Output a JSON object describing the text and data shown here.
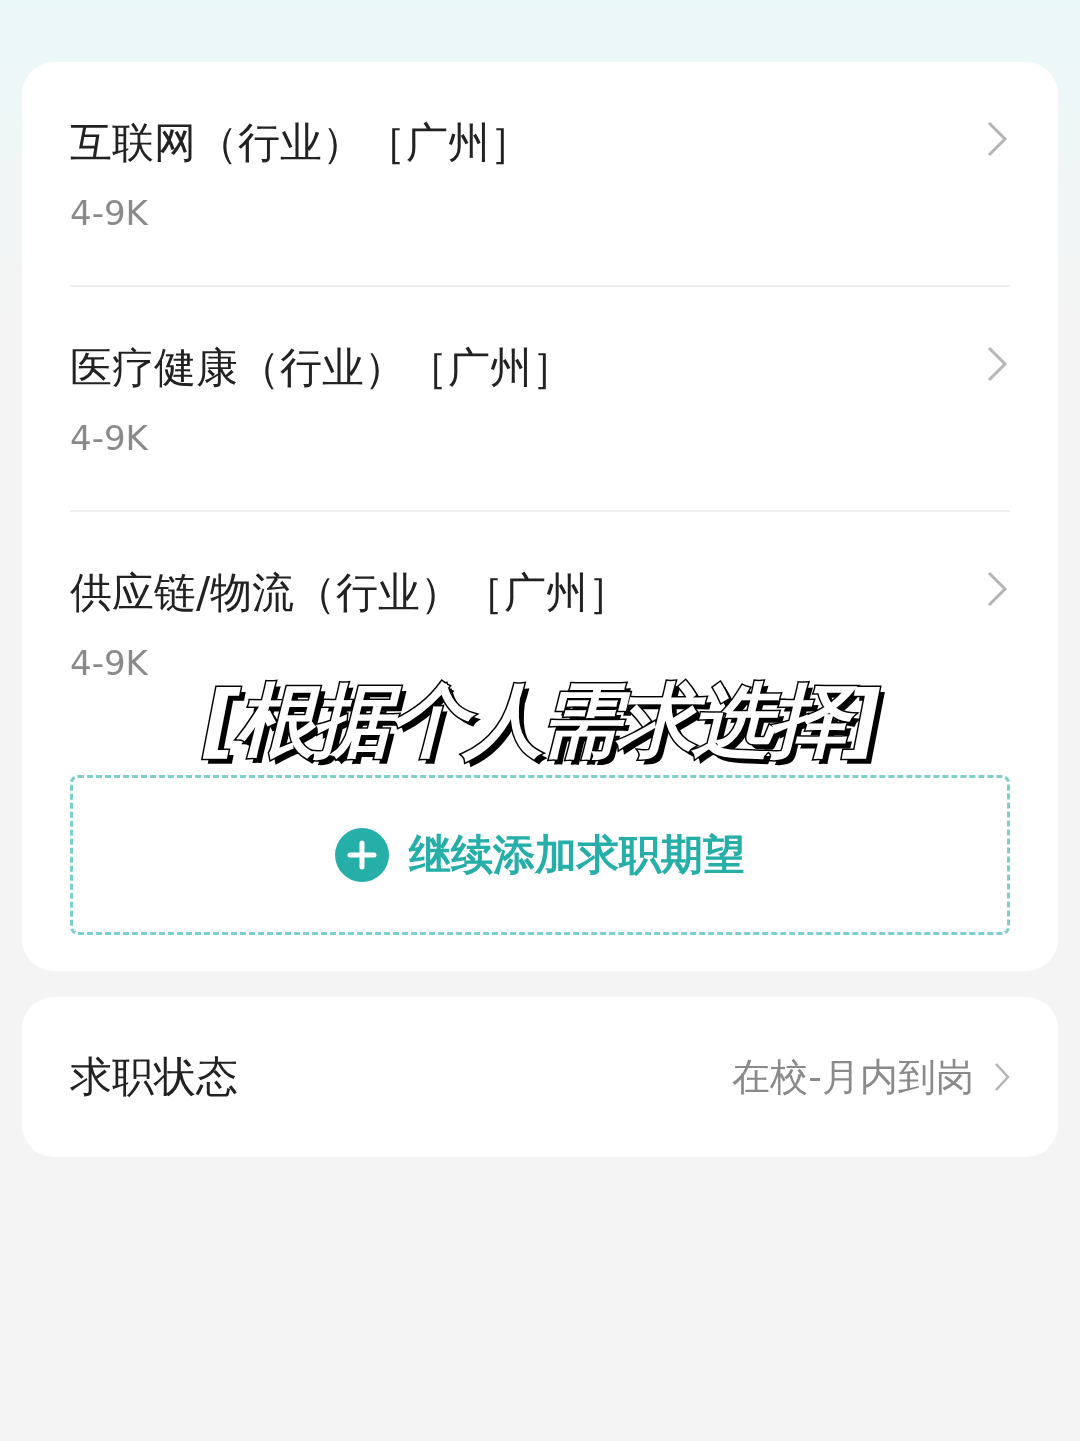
{
  "expectations": [
    {
      "title": "互联网（行业）［广州］",
      "salary": "4-9K"
    },
    {
      "title": "医疗健康（行业）［广州］",
      "salary": "4-9K"
    },
    {
      "title": "供应链/物流（行业）［广州］",
      "salary": "4-9K"
    }
  ],
  "add_button": {
    "label": "继续添加求职期望"
  },
  "status_row": {
    "label": "求职状态",
    "value": "在校-月内到岗"
  },
  "caption": "[根据个人需求选择]"
}
